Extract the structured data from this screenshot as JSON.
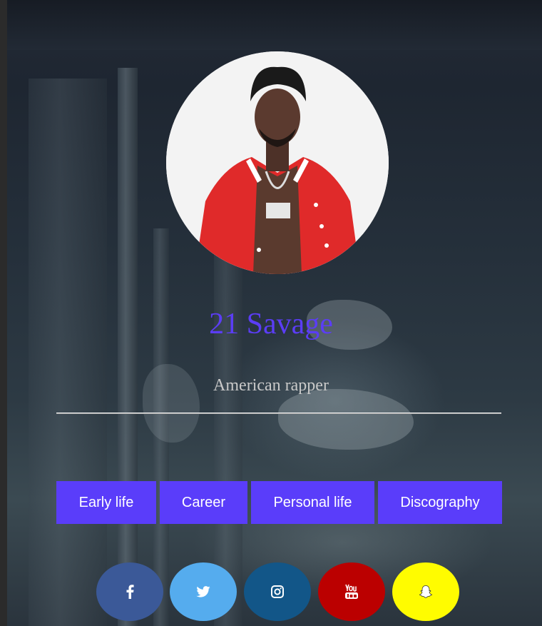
{
  "profile": {
    "name": "21 Savage",
    "subtitle": "American rapper",
    "avatar_icon": "portrait-photo",
    "name_color": "#5b3df5"
  },
  "nav": {
    "items": [
      {
        "label": "Early life"
      },
      {
        "label": "Career"
      },
      {
        "label": "Personal life"
      },
      {
        "label": "Discography"
      }
    ],
    "button_color": "#5a3dfa"
  },
  "social": [
    {
      "name": "facebook",
      "icon": "facebook-icon",
      "color": "#3b5998"
    },
    {
      "name": "twitter",
      "icon": "twitter-icon",
      "color": "#55acee"
    },
    {
      "name": "instagram",
      "icon": "instagram-icon",
      "color": "#125688"
    },
    {
      "name": "youtube",
      "icon": "youtube-icon",
      "color": "#bb0000"
    },
    {
      "name": "snapchat",
      "icon": "snapchat-icon",
      "color": "#fffc00"
    }
  ]
}
